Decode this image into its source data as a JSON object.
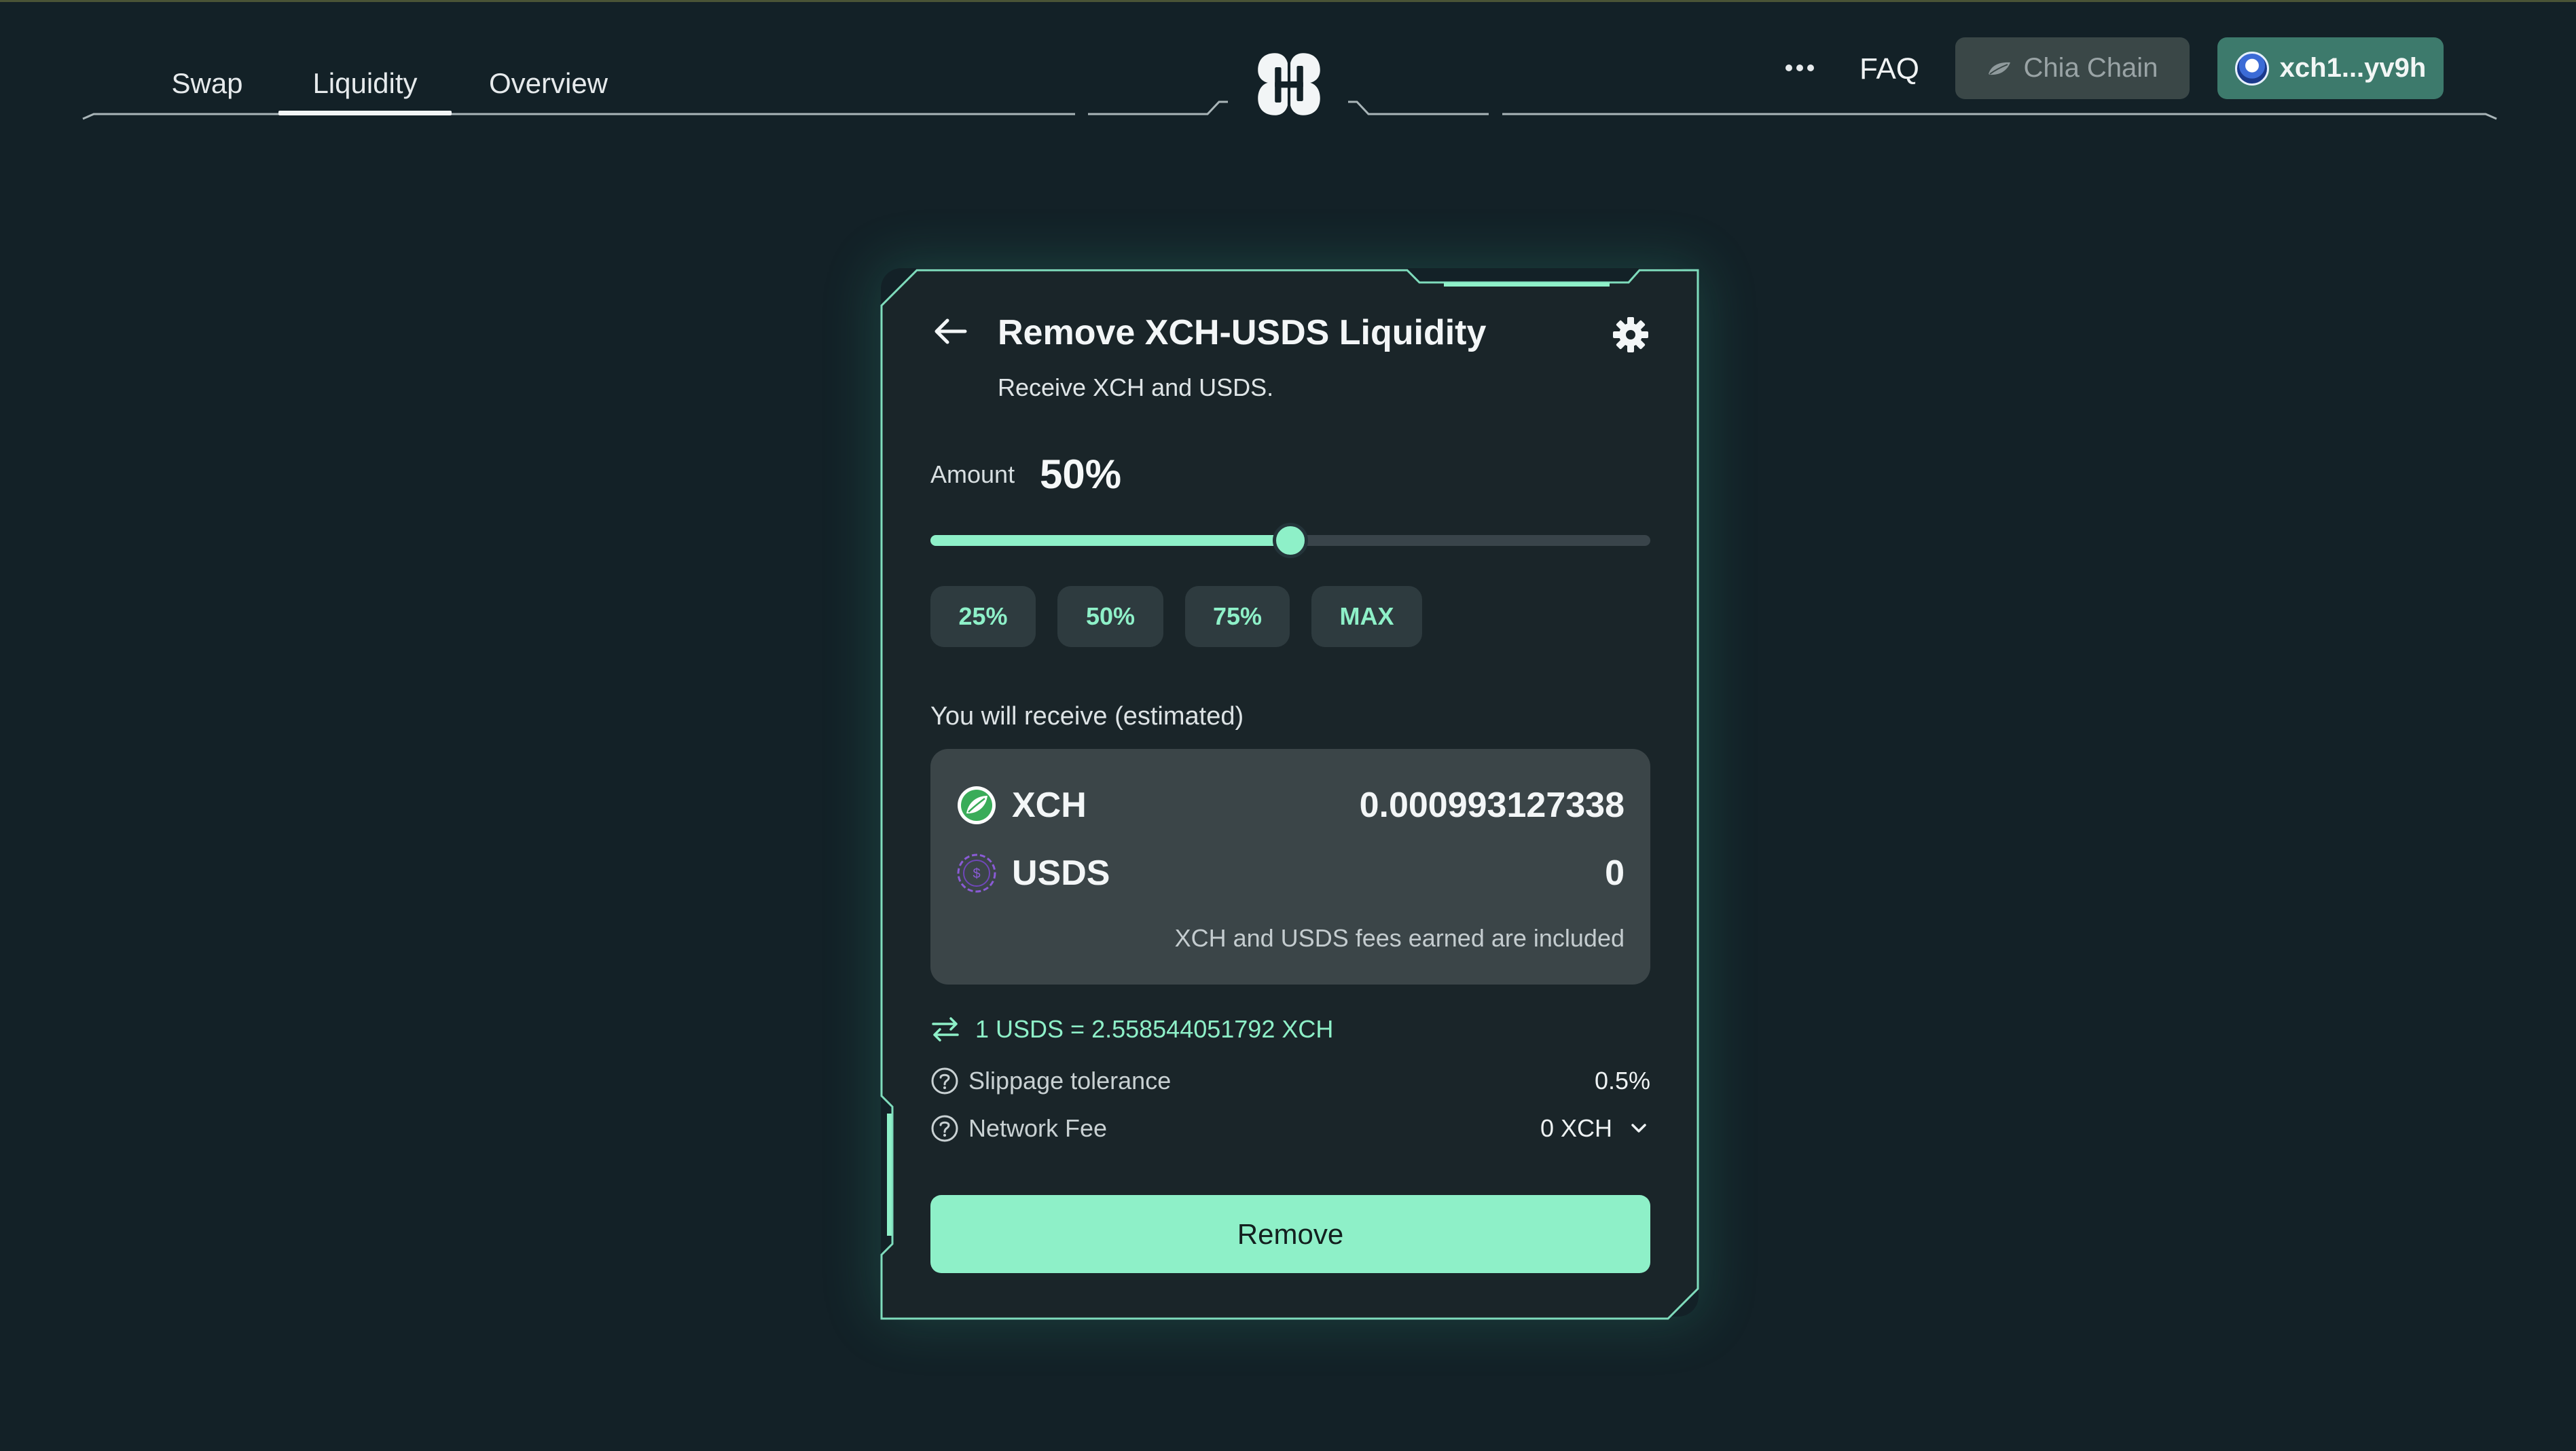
{
  "nav": {
    "items": [
      {
        "label": "Swap"
      },
      {
        "label": "Liquidity",
        "active": true
      },
      {
        "label": "Overview"
      }
    ]
  },
  "header": {
    "logo_icon": "hashgreen-logo-icon",
    "more_icon": "more-dots-icon",
    "faq_label": "FAQ",
    "chain_label": "Chia Chain",
    "chain_icon": "chia-leaf-icon",
    "wallet_label": "xch1...yv9h",
    "wallet_icon": "wallet-avatar-icon"
  },
  "card": {
    "title": "Remove XCH-USDS Liquidity",
    "subtitle": "Receive XCH and USDS.",
    "back_icon": "arrow-left-icon",
    "settings_icon": "gear-icon",
    "amount_label": "Amount",
    "amount_value": "50%",
    "slider_fraction": 0.5,
    "percent_buttons": [
      "25%",
      "50%",
      "75%",
      "MAX"
    ],
    "receive_label": "You will receive (estimated)",
    "tokens": [
      {
        "symbol": "XCH",
        "amount": "0.000993127338",
        "icon": "xch-token-icon"
      },
      {
        "symbol": "USDS",
        "amount": "0",
        "icon": "usds-token-icon"
      }
    ],
    "fees_note": "XCH and USDS fees earned are included",
    "rate": "1 USDS = 2.558544051792 XCH",
    "rate_icon": "swap-arrows-icon",
    "slippage_label": "Slippage tolerance",
    "slippage_value": "0.5%",
    "network_fee_label": "Network Fee",
    "network_fee_value": "0 XCH",
    "remove_label": "Remove"
  },
  "colors": {
    "background": "#132127",
    "card": "#1a2529",
    "accent": "#8ef0c8",
    "receive_box": "#3b4548",
    "wallet_button": "#3d7a6c",
    "chain_button": "#3a4747"
  }
}
